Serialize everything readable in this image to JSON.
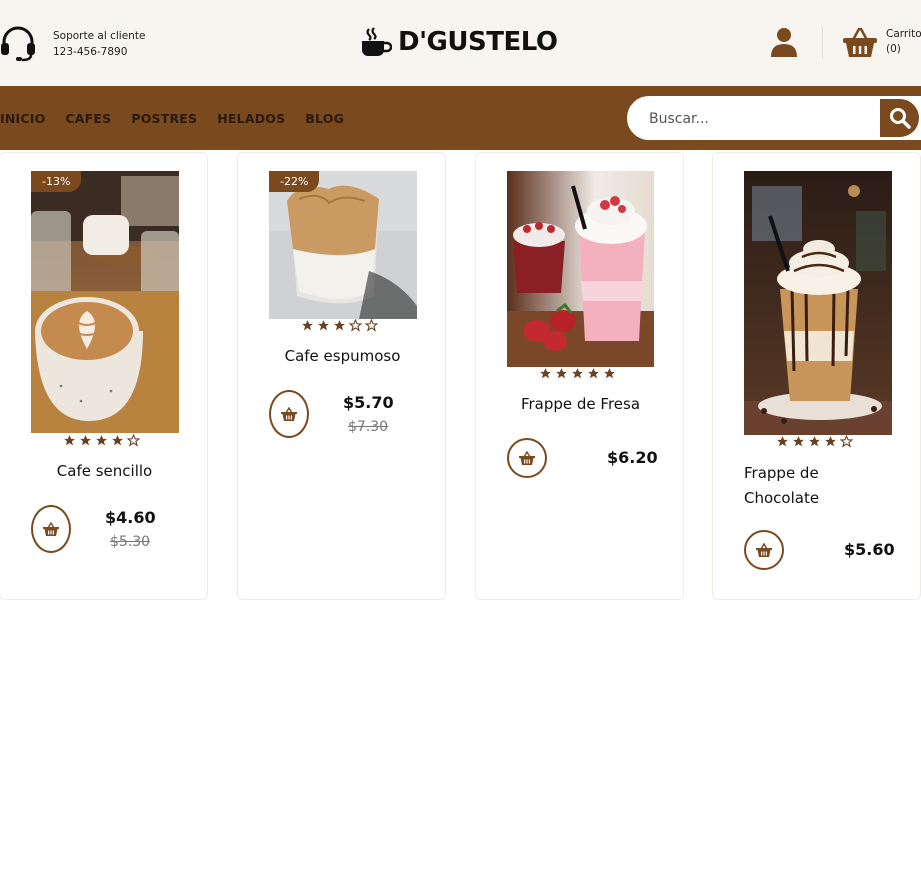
{
  "header": {
    "support_label": "Soporte al cliente",
    "support_phone": "123-456-7890",
    "brand_name": "D'GUSTELO",
    "cart_label": "Carrito",
    "cart_count": "(0)"
  },
  "nav": {
    "items": [
      {
        "label": "INICIO"
      },
      {
        "label": "CAFES"
      },
      {
        "label": "POSTRES"
      },
      {
        "label": "HELADOS"
      },
      {
        "label": "BLOG"
      }
    ]
  },
  "search": {
    "placeholder": "Buscar..."
  },
  "colors": {
    "brand_brown": "#7a4a1e",
    "header_bg": "#f8f4ef"
  },
  "products": [
    {
      "name": "Cafe sencillo",
      "discount": "-13%",
      "rating": 4,
      "price": "$4.60",
      "old_price": "$5.30"
    },
    {
      "name": "Cafe espumoso",
      "discount": "-22%",
      "rating": 3,
      "price": "$5.70",
      "old_price": "$7.30"
    },
    {
      "name": "Frappe de Fresa",
      "discount": "",
      "rating": 5,
      "price": "$6.20",
      "old_price": ""
    },
    {
      "name": "Frappe de Chocolate",
      "discount": "",
      "rating": 4,
      "price": "$5.60",
      "old_price": ""
    }
  ]
}
